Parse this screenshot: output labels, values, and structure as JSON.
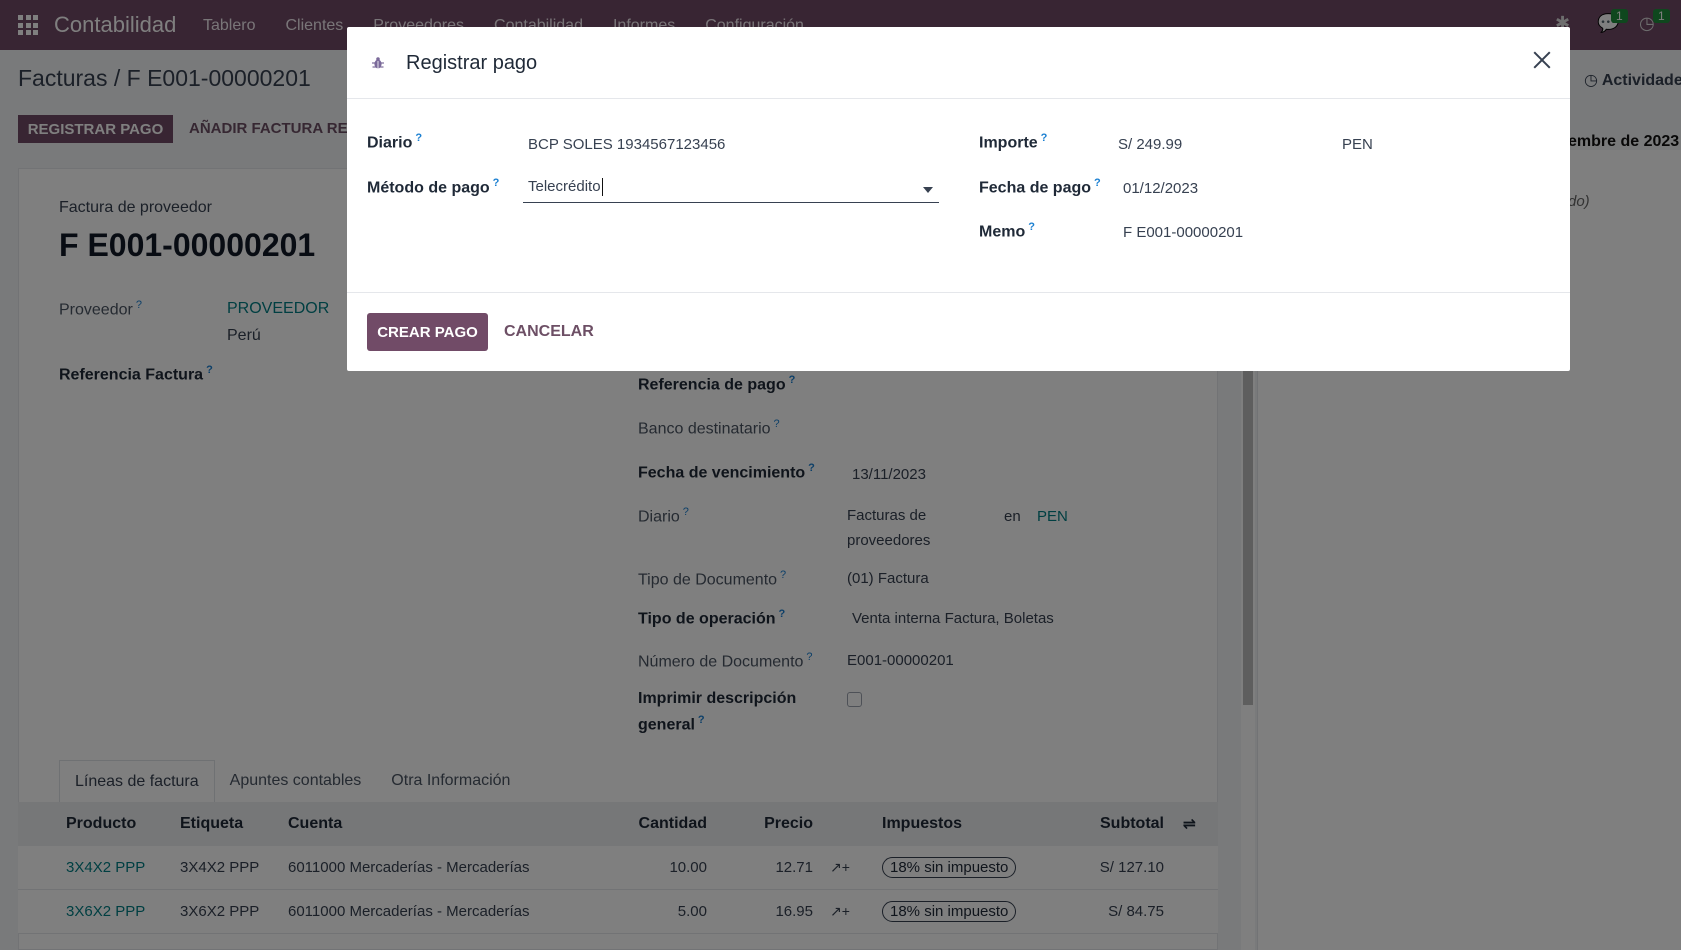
{
  "navbar": {
    "brand": "Contabilidad",
    "menu": [
      "Tablero",
      "Clientes",
      "Proveedores",
      "Contabilidad",
      "Informes",
      "Configuración"
    ],
    "messages_count": "1",
    "activities_count": "1"
  },
  "page": {
    "breadcrumb": "Facturas / F E001-00000201",
    "activity_label": "Actividade",
    "register_button": "REGISTRAR PAGO",
    "add_invoice_button": "AÑADIR FACTURA RE",
    "doc_subtitle": "Factura de proveedor",
    "doc_title": "F E001-00000201",
    "supplier_label": "Proveedor",
    "supplier_line1": "PROVEEDOR",
    "supplier_line2": "Perú",
    "invoice_ref_label": "Referencia Factura",
    "payment_ref_label": "Referencia de pago",
    "bank_label": "Banco destinatario",
    "due_date_label": "Fecha de vencimiento",
    "due_date_value": "13/11/2023",
    "journal_label": "Diario",
    "journal_value_1": "Facturas de",
    "journal_value_2": "proveedores",
    "journal_in": "en",
    "journal_currency": "PEN",
    "doc_type_label": "Tipo de Documento",
    "doc_type_value": "(01) Factura",
    "op_type_label": "Tipo de operación",
    "op_type_value": "Venta interna Factura, Boletas",
    "doc_number_label": "Número de Documento",
    "doc_number_value": "E001-00000201",
    "print_desc_label_1": "Imprimir descripción",
    "print_desc_label_2": "general",
    "chatter_date": "embre de 2023",
    "chatter_note": "do)"
  },
  "tabs": [
    "Líneas de factura",
    "Apuntes contables",
    "Otra Información"
  ],
  "table": {
    "headers": [
      "Producto",
      "Etiqueta",
      "Cuenta",
      "Cantidad",
      "Precio",
      "Impuestos",
      "Subtotal"
    ],
    "rows": [
      {
        "product": "3X4X2 PPP",
        "label": "3X4X2 PPP",
        "account": "6011000 Mercaderías - Mercaderías",
        "qty": "10.00",
        "price": "12.71",
        "tax": "18% sin impuesto",
        "subtotal": "S/ 127.10"
      },
      {
        "product": "3X6X2 PPP",
        "label": "3X6X2 PPP",
        "account": "6011000 Mercaderías - Mercaderías",
        "qty": "5.00",
        "price": "16.95",
        "tax": "18% sin impuesto",
        "subtotal": "S/ 84.75"
      }
    ]
  },
  "modal": {
    "title": "Registrar pago",
    "journal_label": "Diario",
    "journal_value": "BCP SOLES 1934567123456",
    "method_label": "Método de pago",
    "method_value": "Telecrédito",
    "amount_label": "Importe",
    "amount_value": "S/ 249.99",
    "currency_value": "PEN",
    "date_label": "Fecha de pago",
    "date_value": "01/12/2023",
    "memo_label": "Memo",
    "memo_value": "F E001-00000201",
    "help_mark": "?",
    "create_button": "CREAR PAGO",
    "cancel_button": "CANCELAR"
  }
}
